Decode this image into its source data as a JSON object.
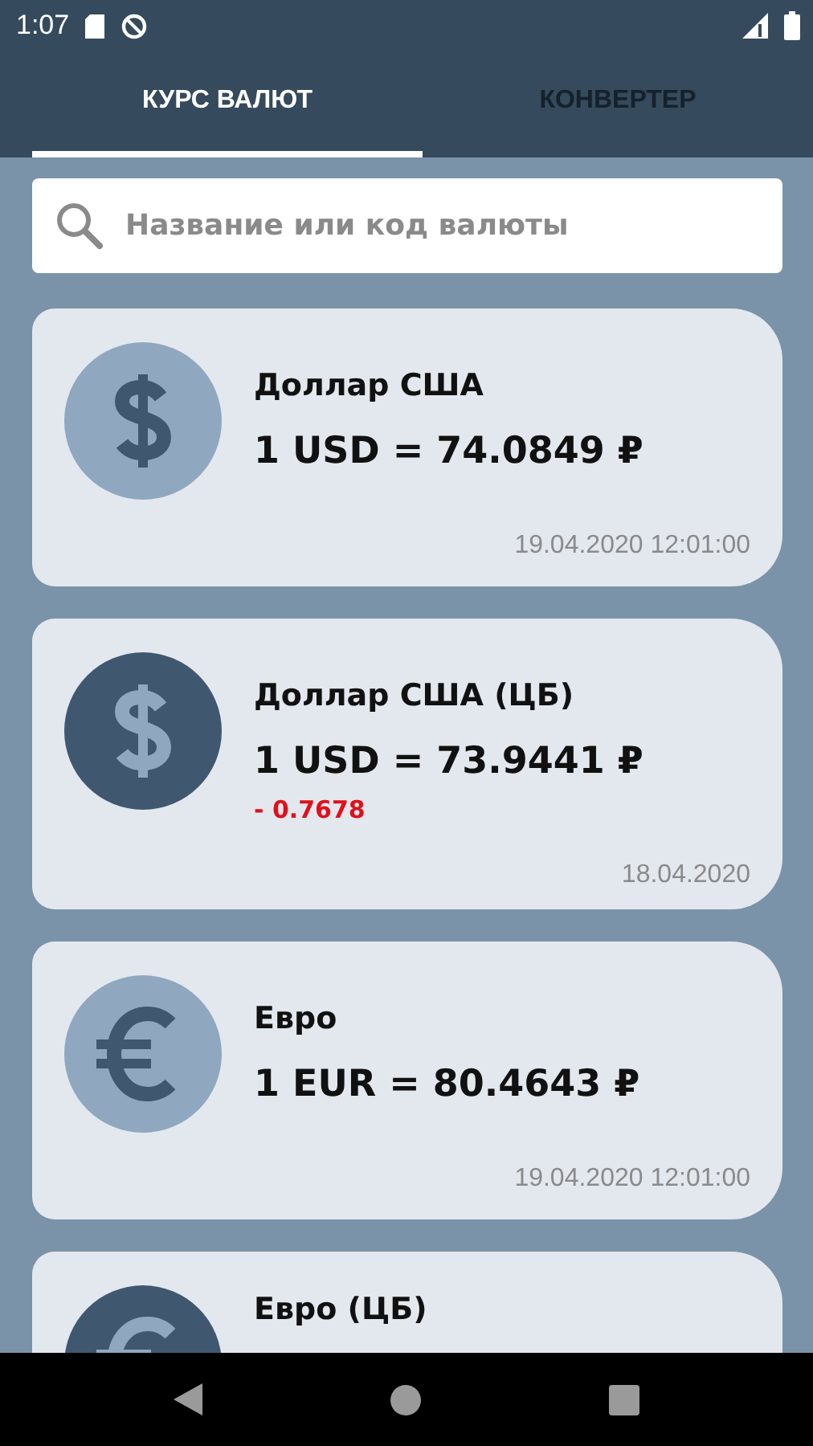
{
  "status_bar": {
    "time": "1:07"
  },
  "tabs": [
    {
      "label": "КУРС ВАЛЮТ",
      "selected": true
    },
    {
      "label": "КОНВЕРТЕР",
      "selected": false
    }
  ],
  "search": {
    "placeholder": "Название или код валюты"
  },
  "rates": [
    {
      "kind": "dollar",
      "official": false,
      "name": "Доллар США",
      "rate": "1 USD = 74.0849 ₽",
      "date": "19.04.2020 12:01:00"
    },
    {
      "kind": "dollar",
      "official": true,
      "name": "Доллар США (ЦБ)",
      "rate": "1 USD = 73.9441 ₽",
      "change": "- 0.7678",
      "color": "#e0101a",
      "date": "18.04.2020"
    },
    {
      "kind": "euro",
      "official": false,
      "name": "Евро",
      "rate": "1 EUR = 80.4643 ₽",
      "date": "19.04.2020 12:01:00"
    },
    {
      "kind": "euro",
      "official": true,
      "name": "Евро (ЦБ)"
    }
  ]
}
